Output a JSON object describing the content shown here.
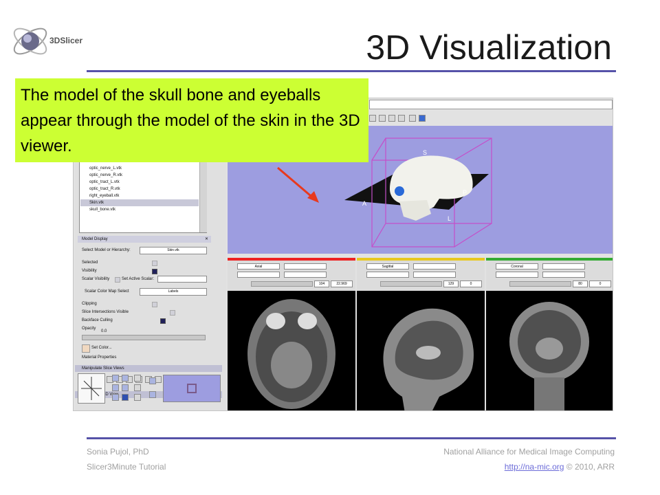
{
  "header": {
    "logo_text": "3DSlicer",
    "title": "3D Visualization"
  },
  "callout": {
    "text": "The model of the skull bone and eyeballs appear through the model of the skin in the 3D viewer."
  },
  "app": {
    "model_list": [
      "optic_nerve_L.vtk",
      "optic_nerve_R.vtk",
      "optic_tract_L.vtk",
      "optic_tract_R.vtk",
      "right_eyeball.vtk",
      "Skin.vtk",
      "skull_bone.vtk"
    ],
    "model_display": {
      "header": "Model Display",
      "select_label": "Select Model or Hierarchy:",
      "select_value": "Skin.vtk",
      "rows": [
        "Selected",
        "Visibility",
        "Scalar Visibility",
        "Scalar Color Map Select",
        "Clipping",
        "Slice Intersections Visible",
        "Backface Culling",
        "Opacity"
      ],
      "active_scalar_label": "Set Active Scalar:",
      "color_map_value": "Labels",
      "opacity_value": "0.0",
      "set_color_label": "Set Color...",
      "material_label": "Material Properties"
    },
    "manipulate_slice_views": "Manipulate Slice Views",
    "manipulate_3d_view": "Manipulate 3D View",
    "orientation_labels": {
      "s": "S",
      "a": "A",
      "p": "P",
      "l": "L"
    },
    "slice_views": [
      {
        "name": "Axial",
        "color": "#ee2222",
        "value1": "104",
        "value2": "22.969"
      },
      {
        "name": "Sagittal",
        "color": "#e8c820",
        "value1": "129",
        "value2": "0"
      },
      {
        "name": "Coronal",
        "color": "#33aa33",
        "value1": "80",
        "value2": "0"
      }
    ],
    "colors": {
      "viewer_bg": "#9d9de0",
      "accent_rule": "#5552a8",
      "callout_bg": "#ccff33",
      "arrow": "#e8391d"
    }
  },
  "footer": {
    "author": "Sonia Pujol, PhD",
    "organization": "National Alliance for Medical Image Computing",
    "tutorial": "Slicer3Minute Tutorial",
    "link": "http://na-mic.org",
    "copyright": "© 2010, ARR"
  }
}
